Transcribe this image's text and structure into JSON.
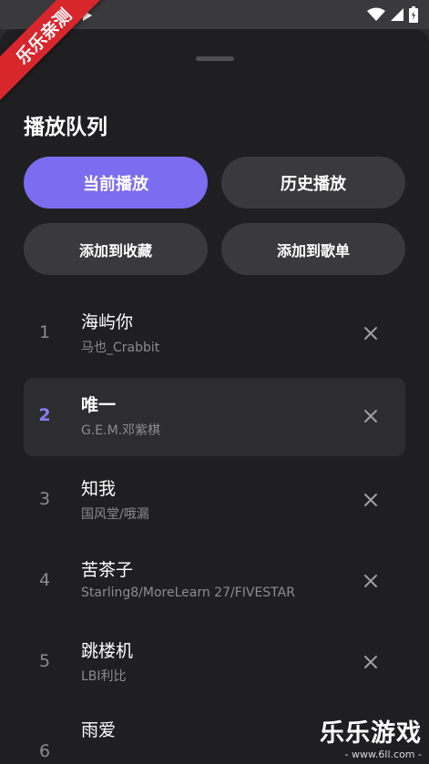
{
  "ribbon_text": "乐乐亲测",
  "sheet": {
    "title": "播放队列",
    "tabs": [
      {
        "label": "当前播放",
        "active": true
      },
      {
        "label": "历史播放",
        "active": false
      }
    ],
    "actions": [
      {
        "label": "添加到收藏"
      },
      {
        "label": "添加到歌单"
      }
    ],
    "queue": [
      {
        "index": "1",
        "song": "海屿你",
        "artist": "马也_Crabbit",
        "active": false
      },
      {
        "index": "2",
        "song": "唯一",
        "artist": "G.E.M.邓紫棋",
        "active": true
      },
      {
        "index": "3",
        "song": "知我",
        "artist": "国风堂/哦漏",
        "active": false
      },
      {
        "index": "4",
        "song": "苦茶子",
        "artist": "Starling8/MoreLearn 27/FIVESTAR",
        "active": false
      },
      {
        "index": "5",
        "song": "跳楼机",
        "artist": "LBI利比",
        "active": false
      },
      {
        "index": "6",
        "song": "雨爱",
        "artist": "",
        "active": false
      }
    ]
  },
  "watermark": {
    "title": "乐乐游戏",
    "url": "- www.6ll.com -"
  },
  "colors": {
    "accent": "#7c6cf0",
    "background": "#1f1f21",
    "pill": "#3a3a3c",
    "ribbon": "#d8262d"
  }
}
